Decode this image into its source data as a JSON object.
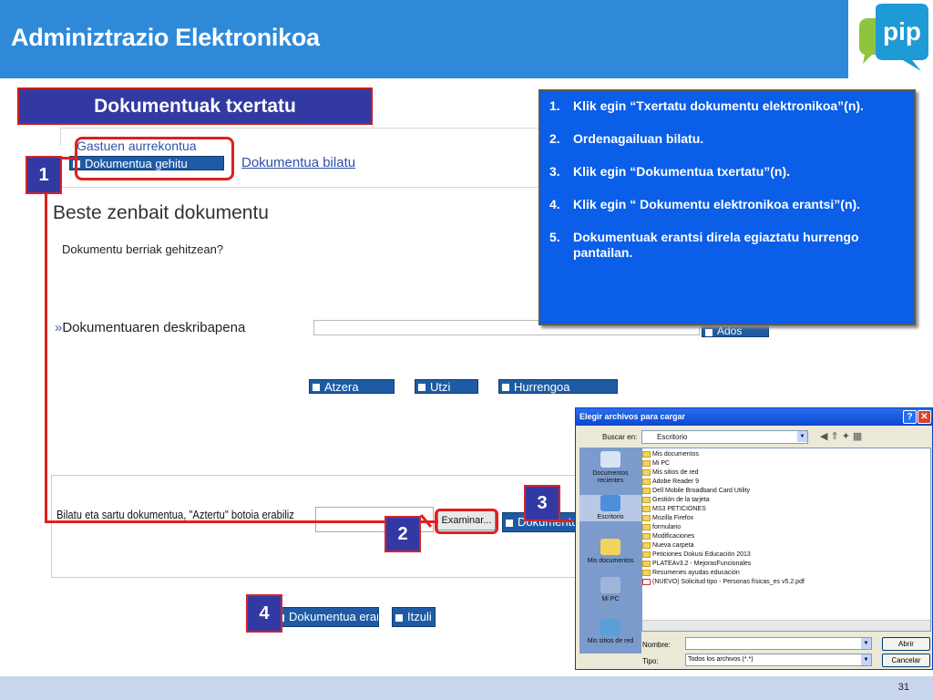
{
  "header": {
    "title": "Adminiztrazio Elektronikoa",
    "logo_text": "pip"
  },
  "section_title": "Dokumentuak txertatu",
  "web_form": {
    "gastuen_label": "Gastuen aurrekontua",
    "gehitu_button": "Dokumentua gehitu",
    "bilatu_link": "Dokumentua bilatu",
    "heading": "Beste zenbait dokumentu",
    "subtext": "Dokumentu berriak gehitzean?",
    "description_label": "Dokumentuaren deskribapena",
    "desc_arrow": "»",
    "add_button": "Ados",
    "atzera_button": "Atzera",
    "utzi_button": "Utzi",
    "hurrengoa_button": "Hurrengoa",
    "upload_instruction": "Bilatu eta sartu dokumentua, \"Aztertu\" botoia erabiliz",
    "examinar_button": "Examinar...",
    "txertatu_button": "Dokumentua txertatu",
    "erantsi_button": "Dokumentua erantsi",
    "itzuli_button": "Itzuli"
  },
  "markers": [
    "1",
    "2",
    "3",
    "4"
  ],
  "instructions": [
    {
      "n": "1.",
      "text": "Klik egin “Txertatu dokumentu elektronikoa”(n)."
    },
    {
      "n": "2.",
      "text": "Ordenagailuan bilatu."
    },
    {
      "n": "3.",
      "text": "Klik egin “Dokumentua txertatu”(n)."
    },
    {
      "n": "4.",
      "text": "Klik egin “ Dokumentu elektronikoa erantsi”(n)."
    },
    {
      "n": "5.",
      "text": "Dokumentuak erantsi direla egiaztatu hurrengo pantailan."
    }
  ],
  "file_dialog": {
    "title": "Elegir archivos para cargar",
    "buscar_label": "Buscar en:",
    "buscar_value": "Escritorio",
    "places": [
      "Documentos recientes",
      "Escritorio",
      "Mis documentos",
      "Mi PC",
      "Mis sitios de red"
    ],
    "files": [
      "Mis documentos",
      "Mi PC",
      "Mis sitios de red",
      "Adobe Reader 9",
      "Dell Mobile Broadband Card Utility",
      "Gestión de la tarjeta",
      "MS3 PETICIONES",
      "Mozilla Firefox",
      "formulario",
      "Modificaciones",
      "Nueva carpeta",
      "Peticiones Dokusi Educación 2013",
      "PLATEAv3.2 - MejorasFuncionales",
      "Resumenes ayudas educación",
      "(NUEVO) Solicitud tipo - Personas físicas_es v5.2.pdf"
    ],
    "nombre_label": "Nombre:",
    "tipo_label": "Tipo:",
    "tipo_value": "Todos los archivos (*.*)",
    "abrir_button": "Abrir",
    "cancelar_button": "Cancelar"
  },
  "page_number": "31",
  "colors": {
    "header_bg": "#2e8ad8",
    "accent_navy": "#3339a2",
    "annotation_red": "#e02020",
    "instructions_bg": "#0a5ee8"
  }
}
